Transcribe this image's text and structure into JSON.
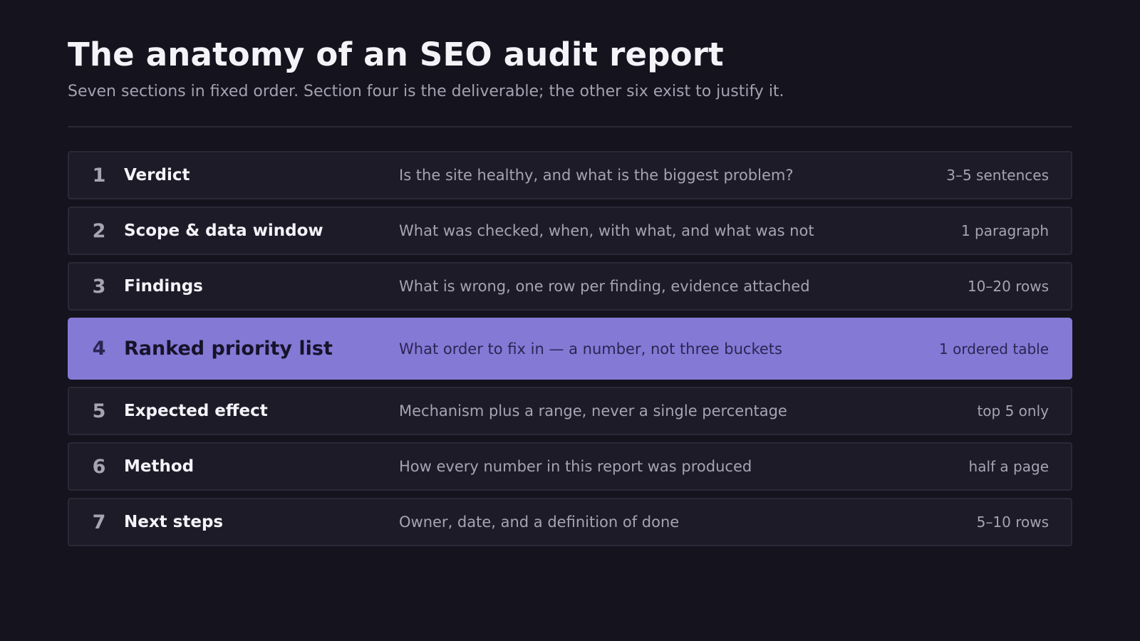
{
  "header": {
    "title": "The anatomy of an SEO audit report",
    "subtitle": "Seven sections in fixed order. Section four is the deliverable; the other six exist to justify it."
  },
  "sections": [
    {
      "num": "1",
      "name": "Verdict",
      "question": "Is the site healthy, and what is the biggest problem?",
      "length": "3–5 sentences"
    },
    {
      "num": "2",
      "name": "Scope & data window",
      "question": "What was checked, when, with what, and what was not",
      "length": "1 paragraph"
    },
    {
      "num": "3",
      "name": "Findings",
      "question": "What is wrong, one row per finding, evidence attached",
      "length": "10–20 rows"
    },
    {
      "num": "4",
      "name": "Ranked priority list",
      "question": "What order to fix in — a number, not three buckets",
      "length": "1 ordered table",
      "highlighted": true
    },
    {
      "num": "5",
      "name": "Expected effect",
      "question": "Mechanism plus a range, never a single percentage",
      "length": "top 5 only"
    },
    {
      "num": "6",
      "name": "Method",
      "question": "How every number in this report was produced",
      "length": "half a page"
    },
    {
      "num": "7",
      "name": "Next steps",
      "question": "Owner, date, and a definition of done",
      "length": "5–10 rows"
    }
  ],
  "colors": {
    "background": "#15131d",
    "row_background": "#1d1b28",
    "row_border": "#2b2937",
    "highlight": "#8579d6",
    "muted_text": "#a6a3b3",
    "bright_text": "#f4f3f8"
  }
}
